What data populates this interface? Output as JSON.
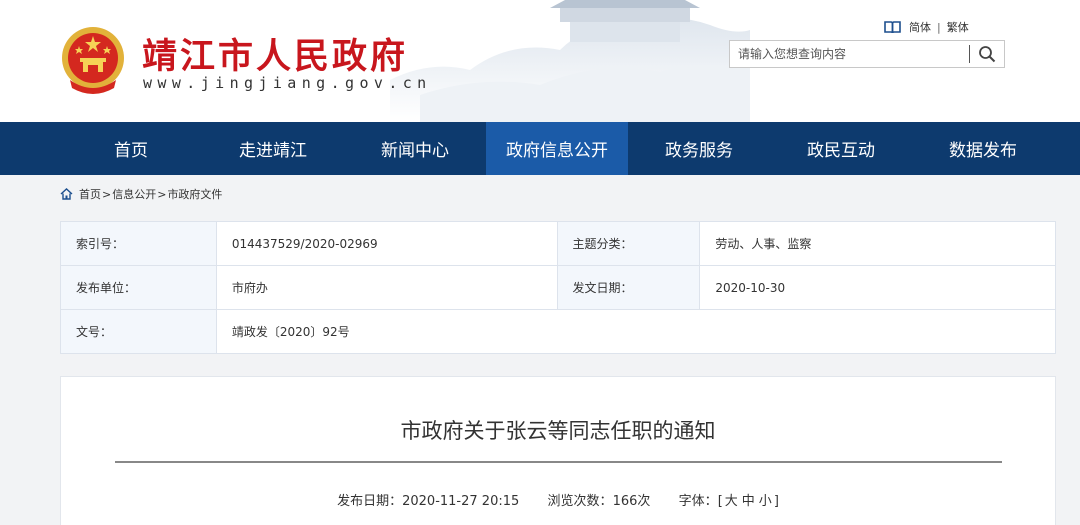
{
  "header": {
    "site_title": "靖江市人民政府",
    "site_url": "www.jingjiang.gov.cn",
    "lang_simplified": "简体",
    "lang_separator": "|",
    "lang_traditional": "繁体",
    "search_placeholder": "请输入您想查询内容"
  },
  "nav": {
    "items": [
      {
        "label": "首页"
      },
      {
        "label": "走进靖江"
      },
      {
        "label": "新闻中心"
      },
      {
        "label": "政府信息公开",
        "active": true
      },
      {
        "label": "政务服务"
      },
      {
        "label": "政民互动"
      },
      {
        "label": "数据发布"
      }
    ]
  },
  "breadcrumb": {
    "home": "首页",
    "sep": ">",
    "level1": "信息公开",
    "level2": "市政府文件"
  },
  "info": {
    "index_label": "索引号：",
    "index_value": "014437529/2020-02969",
    "topic_label": "主题分类：",
    "topic_value": "劳动、人事、监察",
    "publisher_label": "发布单位：",
    "publisher_value": "市府办",
    "date_label": "发文日期：",
    "date_value": "2020-10-30",
    "docno_label": "文号：",
    "docno_value": "靖政发〔2020〕92号"
  },
  "article": {
    "title": "市政府关于张云等同志任职的通知",
    "publish_label": "发布日期：",
    "publish_value": "2020-11-27 20:15",
    "views_label": "浏览次数：",
    "views_value": "166次",
    "font_label": "字体：",
    "font_open": "[",
    "font_large": "大",
    "font_medium": "中",
    "font_small": "小",
    "font_close": "]"
  },
  "colors": {
    "nav_bg": "#0d3a6e",
    "nav_active": "#1b5ba8",
    "title_red": "#c8161d"
  },
  "icons": [
    "national-emblem",
    "book-icon",
    "search-icon",
    "home-icon"
  ]
}
